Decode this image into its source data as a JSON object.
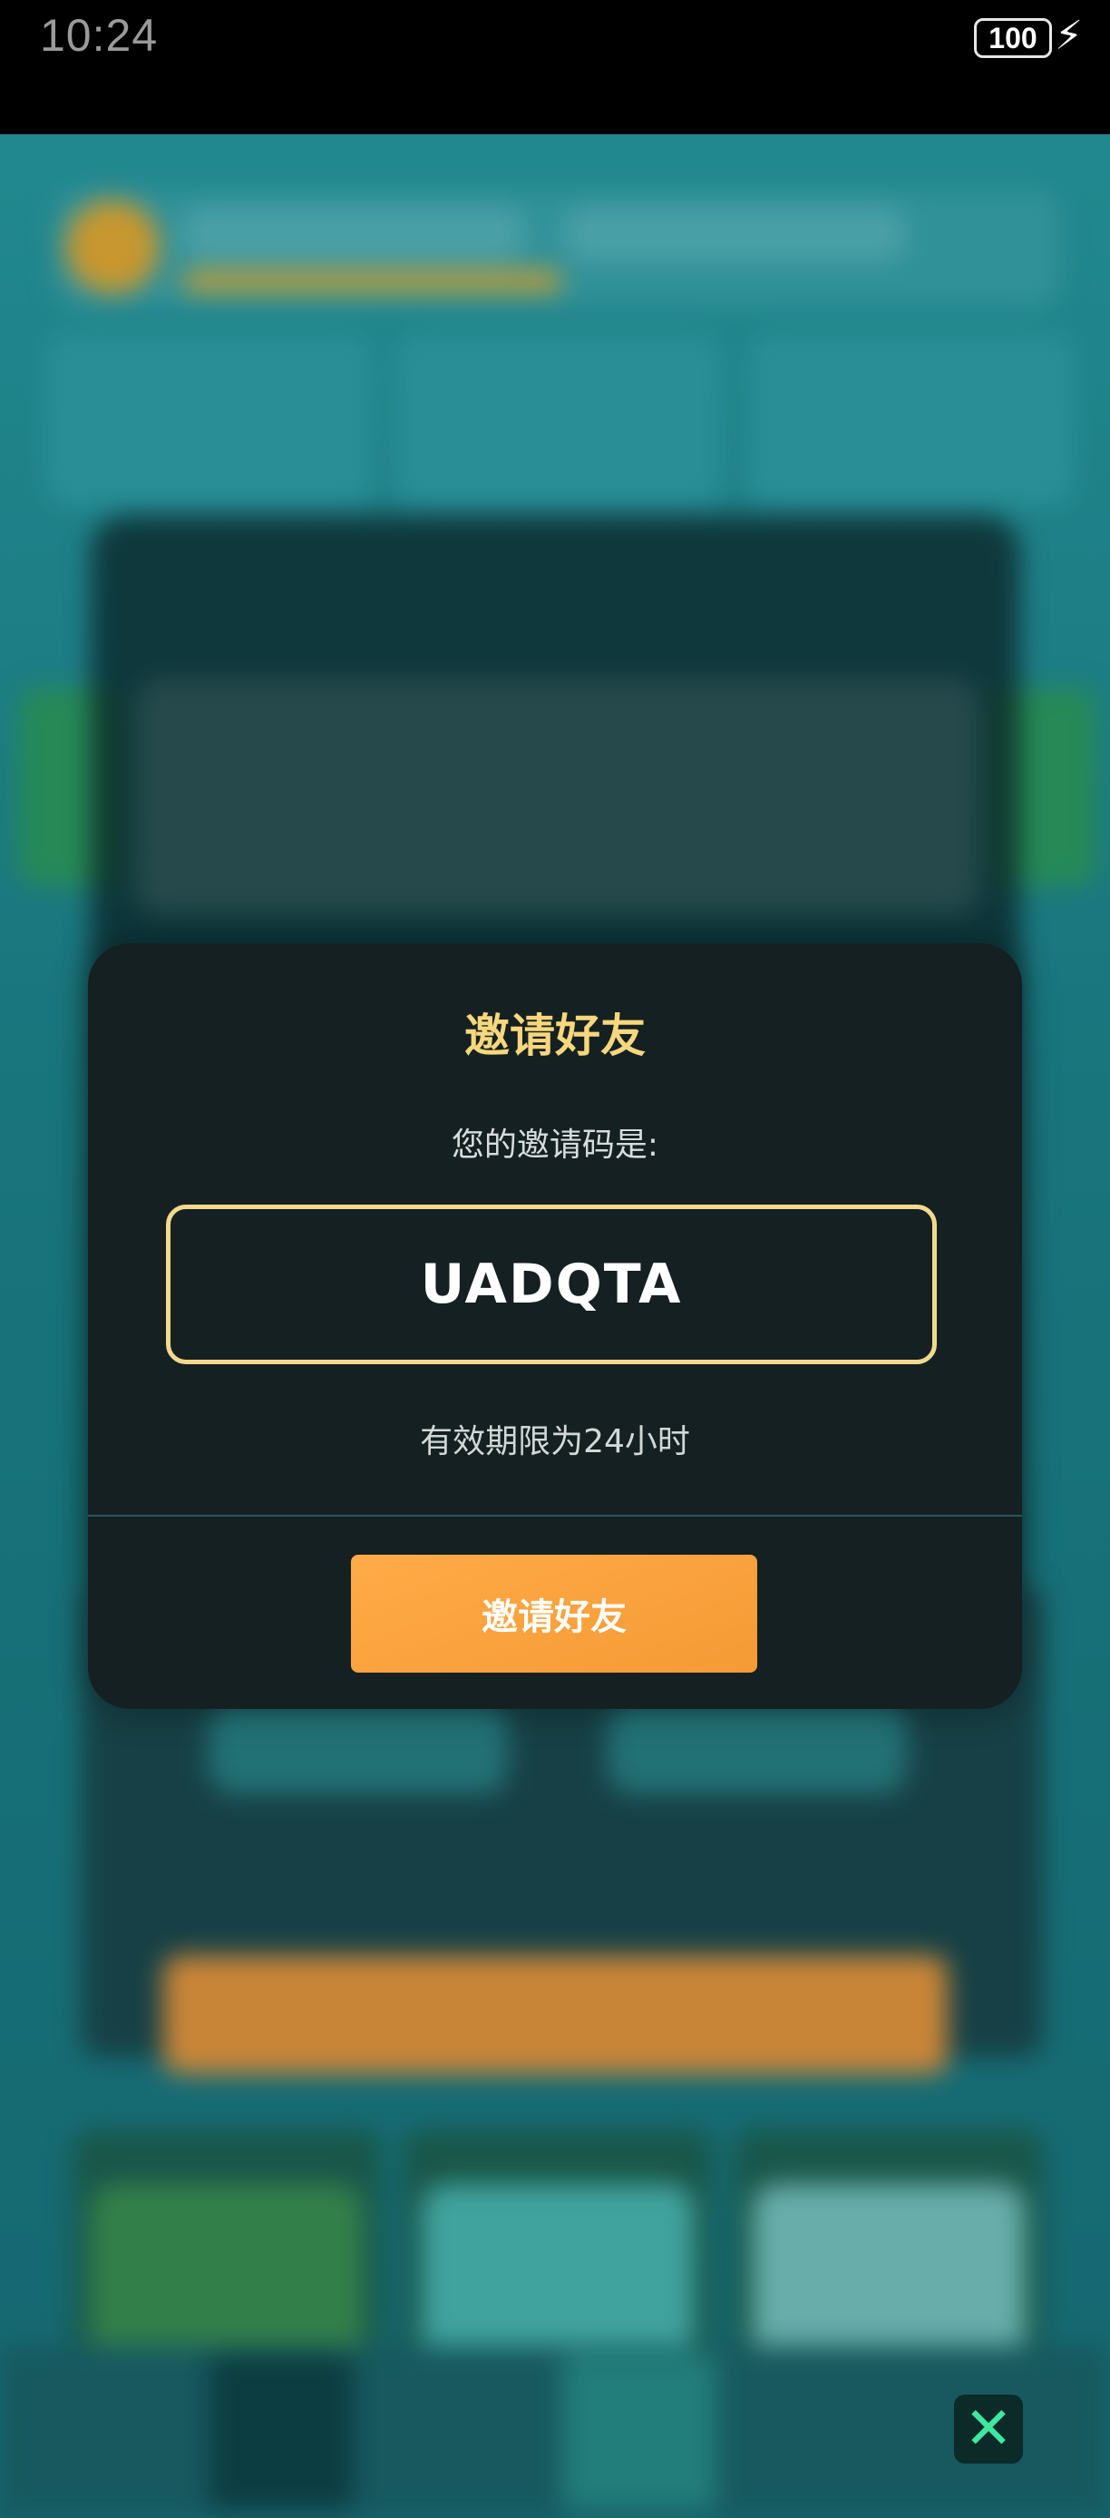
{
  "status_bar": {
    "time": "10:24",
    "battery": "100"
  },
  "modal": {
    "title": "邀请好友",
    "subtitle": "您的邀请码是:",
    "invite_code": "UADQTA",
    "validity": "有效期限为24小时",
    "button_label": "邀请好友"
  },
  "icons": {
    "close": "close-icon",
    "bolt": "charging-bolt-icon"
  },
  "colors": {
    "title": "#f6d77c",
    "code_border": "#f3d98c",
    "button": "#ffab47",
    "modal_bg": "#152022"
  }
}
